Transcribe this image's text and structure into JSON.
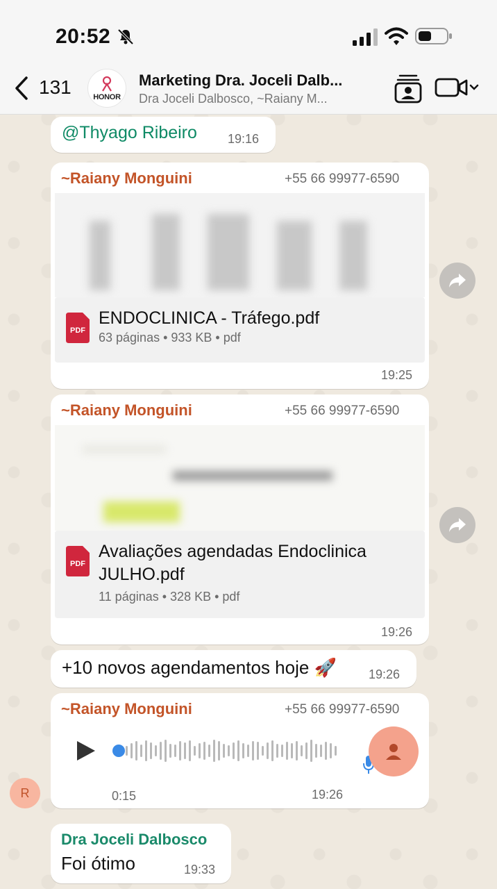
{
  "status_bar": {
    "time": "20:52"
  },
  "header": {
    "back_count": "131",
    "avatar_text": "HONOR",
    "title": "Marketing Dra. Joceli Dalb...",
    "subtitle": "Dra Joceli Dalbosco, ~Raiany M..."
  },
  "messages": {
    "m1": {
      "mention": "@Thyago Ribeiro",
      "time": "19:16"
    },
    "m2": {
      "sender": "~Raiany Monguini",
      "phone": "+55 66 99977-6590",
      "doc_name": "ENDOCLINICA - Tráfego.pdf",
      "doc_meta": "63 páginas • 933 KB • pdf",
      "pdf_badge": "PDF",
      "time": "19:25"
    },
    "m3": {
      "sender": "~Raiany Monguini",
      "phone": "+55 66 99977-6590",
      "doc_name_line1": "Avaliações agendadas Endoclinica",
      "doc_name_line2": "JULHO.pdf",
      "doc_meta": "11 páginas • 328 KB • pdf",
      "pdf_badge": "PDF",
      "time": "19:26"
    },
    "m4": {
      "text": "+10 novos agendamentos hoje 🚀",
      "time": "19:26"
    },
    "m5": {
      "sender": "~Raiany Monguini",
      "phone": "+55 66 99977-6590",
      "duration": "0:15",
      "time": "19:26",
      "progress": 0.0
    },
    "m6": {
      "sender": "Dra Joceli Dalbosco",
      "text": "Foi ótimo",
      "time": "19:33"
    }
  },
  "sender_avatar_initial": "R",
  "colors": {
    "sender_name": "#c35428",
    "mention": "#0e8a65",
    "admin_name": "#1a8a6a",
    "pdf_red": "#d0263d",
    "voice_avatar": "#f4a28c",
    "play_dot": "#3a8ae6"
  },
  "icons": [
    "back-chevron-icon",
    "bell-slash-icon",
    "signal-icon",
    "wifi-icon",
    "battery-icon",
    "contacts-icon",
    "video-call-icon",
    "pdf-icon",
    "forward-icon",
    "play-icon",
    "mic-icon",
    "person-icon"
  ]
}
